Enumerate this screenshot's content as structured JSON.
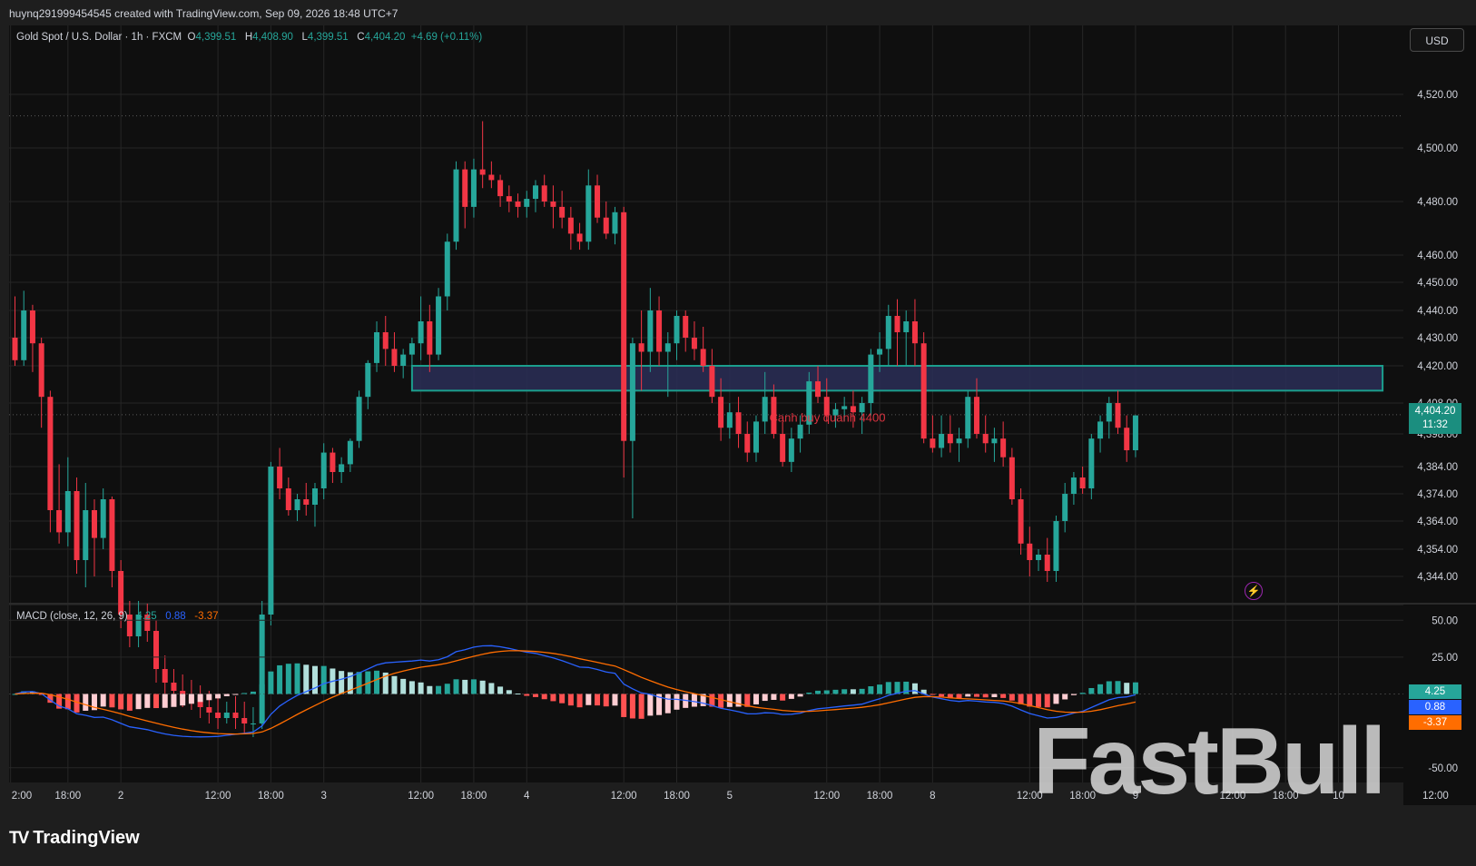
{
  "header": {
    "created_text": "huynq291999454545 created with TradingView.com, Sep 09, 2026 18:48 UTC+7"
  },
  "legend": {
    "symbol": "Gold Spot / U.S. Dollar · 1h · FXCM",
    "o_label": "O",
    "o_value": "4,399.51",
    "h_label": "H",
    "h_value": "4,408.90",
    "l_label": "L",
    "l_value": "4,399.51",
    "c_label": "C",
    "c_value": "4,404.20",
    "change": "+4.69 (+0.11%)"
  },
  "currency": "USD",
  "last_price": {
    "price": "4,404.20",
    "countdown": "11:32"
  },
  "macd_legend": {
    "label": "MACD (close, 12, 26, 9)",
    "macd": "4.25",
    "signal": "0.88",
    "hist": "-3.37"
  },
  "colors": {
    "up": "#26a69a",
    "down": "#f23645",
    "macd": "#2962ff",
    "signal": "#ff6d00",
    "zone": "#2a2e57",
    "zone_border": "#1b9e8d"
  },
  "footer": {
    "brand": "TradingView"
  },
  "watermark": "FastBull",
  "chart_data": {
    "type": "candlestick",
    "price_axis": {
      "ticks": [
        4344,
        4354,
        4364,
        4374,
        4384,
        4398,
        4408,
        4420,
        4430,
        4440,
        4450,
        4460,
        4480,
        4500,
        4520
      ],
      "tick_labels": [
        "4,344.00",
        "4,354.00",
        "4,364.00",
        "4,374.00",
        "4,384.00",
        "4,398.00",
        "4,408.00",
        "4,420.00",
        "4,430.00",
        "4,440.00",
        "4,450.00",
        "4,460.00",
        "4,480.00",
        "4,500.00",
        "4,520.00"
      ]
    },
    "time_axis": {
      "labels": [
        "2:00",
        "18:00",
        "2",
        "12:00",
        "18:00",
        "3",
        "12:00",
        "18:00",
        "4",
        "12:00",
        "18:00",
        "5",
        "12:00",
        "18:00",
        "8",
        "12:00",
        "18:00",
        "9",
        "12:00",
        "18:00",
        "10",
        "12:00"
      ],
      "label_bar_index": [
        -0.5,
        6,
        12,
        23,
        29,
        35,
        46,
        52,
        58,
        69,
        75,
        81,
        92,
        98,
        104,
        115,
        121,
        127,
        138,
        144,
        150,
        161
      ]
    },
    "annotation": {
      "text": "Canh buy quanh 4400",
      "zone_low": 4412,
      "zone_high": 4420,
      "zone_start_bar": 45,
      "zone_end_bar": 155
    },
    "candles": [
      [
        4430,
        4445,
        4420,
        4422
      ],
      [
        4422,
        4447,
        4420,
        4440
      ],
      [
        4440,
        4442,
        4418,
        4428
      ],
      [
        4428,
        4430,
        4400,
        4410
      ],
      [
        4410,
        4412,
        4360,
        4368
      ],
      [
        4368,
        4385,
        4356,
        4360
      ],
      [
        4360,
        4388,
        4355,
        4375
      ],
      [
        4375,
        4380,
        4345,
        4350
      ],
      [
        4350,
        4378,
        4340,
        4368
      ],
      [
        4368,
        4372,
        4344,
        4358
      ],
      [
        4358,
        4376,
        4354,
        4372
      ],
      [
        4372,
        4373,
        4340,
        4346
      ],
      [
        4346,
        4350,
        4325,
        4330
      ],
      [
        4330,
        4335,
        4318,
        4322
      ],
      [
        4322,
        4335,
        4318,
        4330
      ],
      [
        4330,
        4334,
        4320,
        4324
      ],
      [
        4324,
        4328,
        4305,
        4310
      ],
      [
        4310,
        4315,
        4300,
        4305
      ],
      [
        4305,
        4310,
        4298,
        4302
      ],
      [
        4302,
        4308,
        4296,
        4300
      ],
      [
        4300,
        4306,
        4295,
        4298
      ],
      [
        4298,
        4304,
        4292,
        4296
      ],
      [
        4296,
        4302,
        4290,
        4294
      ],
      [
        4294,
        4300,
        4288,
        4292
      ],
      [
        4292,
        4298,
        4290,
        4294
      ],
      [
        4294,
        4300,
        4288,
        4292
      ],
      [
        4292,
        4298,
        4286,
        4290
      ],
      [
        4290,
        4296,
        4285,
        4290
      ],
      [
        4290,
        4335,
        4288,
        4330
      ],
      [
        4330,
        4386,
        4326,
        4384
      ],
      [
        4384,
        4392,
        4372,
        4376
      ],
      [
        4376,
        4380,
        4366,
        4368
      ],
      [
        4368,
        4374,
        4364,
        4372
      ],
      [
        4372,
        4378,
        4366,
        4370
      ],
      [
        4370,
        4378,
        4362,
        4376
      ],
      [
        4376,
        4394,
        4372,
        4390
      ],
      [
        4390,
        4392,
        4378,
        4382
      ],
      [
        4382,
        4388,
        4378,
        4385
      ],
      [
        4385,
        4396,
        4382,
        4395
      ],
      [
        4395,
        4412,
        4392,
        4410
      ],
      [
        4410,
        4422,
        4406,
        4421
      ],
      [
        4421,
        4436,
        4418,
        4432
      ],
      [
        4432,
        4438,
        4420,
        4426
      ],
      [
        4426,
        4432,
        4418,
        4420
      ],
      [
        4420,
        4426,
        4416,
        4424
      ],
      [
        4424,
        4430,
        4420,
        4428
      ],
      [
        4428,
        4445,
        4422,
        4436
      ],
      [
        4436,
        4442,
        4418,
        4424
      ],
      [
        4424,
        4448,
        4422,
        4445
      ],
      [
        4445,
        4468,
        4440,
        4465
      ],
      [
        4465,
        4495,
        4462,
        4492
      ],
      [
        4492,
        4495,
        4470,
        4478
      ],
      [
        4478,
        4496,
        4474,
        4492
      ],
      [
        4492,
        4510,
        4485,
        4490
      ],
      [
        4490,
        4495,
        4485,
        4488
      ],
      [
        4488,
        4490,
        4478,
        4482
      ],
      [
        4482,
        4486,
        4476,
        4480
      ],
      [
        4480,
        4483,
        4474,
        4478
      ],
      [
        4478,
        4484,
        4474,
        4481
      ],
      [
        4481,
        4488,
        4476,
        4486
      ],
      [
        4486,
        4490,
        4478,
        4480
      ],
      [
        4480,
        4486,
        4470,
        4478
      ],
      [
        4478,
        4484,
        4470,
        4474
      ],
      [
        4474,
        4478,
        4462,
        4468
      ],
      [
        4468,
        4472,
        4462,
        4465
      ],
      [
        4465,
        4492,
        4462,
        4486
      ],
      [
        4486,
        4490,
        4472,
        4474
      ],
      [
        4474,
        4480,
        4466,
        4468
      ],
      [
        4468,
        4478,
        4464,
        4476
      ],
      [
        4476,
        4478,
        4380,
        4395
      ],
      [
        4395,
        4430,
        4365,
        4428
      ],
      [
        4428,
        4440,
        4412,
        4425
      ],
      [
        4425,
        4448,
        4418,
        4440
      ],
      [
        4440,
        4445,
        4420,
        4425
      ],
      [
        4425,
        4432,
        4410,
        4428
      ],
      [
        4428,
        4440,
        4422,
        4438
      ],
      [
        4438,
        4440,
        4425,
        4430
      ],
      [
        4430,
        4436,
        4422,
        4426
      ],
      [
        4426,
        4434,
        4418,
        4420
      ],
      [
        4420,
        4426,
        4408,
        4410
      ],
      [
        4410,
        4416,
        4395,
        4400
      ],
      [
        4400,
        4408,
        4396,
        4405
      ],
      [
        4405,
        4410,
        4392,
        4398
      ],
      [
        4398,
        4402,
        4386,
        4390
      ],
      [
        4390,
        4404,
        4386,
        4402
      ],
      [
        4402,
        4418,
        4398,
        4410
      ],
      [
        4410,
        4414,
        4396,
        4398
      ],
      [
        4398,
        4402,
        4384,
        4386
      ],
      [
        4386,
        4400,
        4382,
        4396
      ],
      [
        4396,
        4404,
        4390,
        4401
      ],
      [
        4401,
        4418,
        4398,
        4415
      ],
      [
        4415,
        4420,
        4408,
        4410
      ],
      [
        4410,
        4416,
        4402,
        4404
      ],
      [
        4404,
        4408,
        4400,
        4406
      ],
      [
        4406,
        4410,
        4402,
        4407
      ],
      [
        4407,
        4412,
        4400,
        4405
      ],
      [
        4405,
        4410,
        4398,
        4408
      ],
      [
        4408,
        4426,
        4404,
        4424
      ],
      [
        4424,
        4432,
        4418,
        4426
      ],
      [
        4426,
        4442,
        4420,
        4438
      ],
      [
        4438,
        4444,
        4420,
        4432
      ],
      [
        4432,
        4440,
        4420,
        4436
      ],
      [
        4436,
        4444,
        4420,
        4428
      ],
      [
        4428,
        4432,
        4394,
        4396
      ],
      [
        4396,
        4404,
        4390,
        4392
      ],
      [
        4392,
        4404,
        4388,
        4398
      ],
      [
        4398,
        4404,
        4390,
        4394
      ],
      [
        4394,
        4400,
        4386,
        4396
      ],
      [
        4396,
        4412,
        4392,
        4410
      ],
      [
        4410,
        4416,
        4396,
        4398
      ],
      [
        4398,
        4404,
        4390,
        4394
      ],
      [
        4394,
        4400,
        4386,
        4396
      ],
      [
        4396,
        4402,
        4384,
        4388
      ],
      [
        4388,
        4392,
        4370,
        4372
      ],
      [
        4372,
        4376,
        4352,
        4356
      ],
      [
        4356,
        4362,
        4344,
        4350
      ],
      [
        4350,
        4354,
        4346,
        4352
      ],
      [
        4352,
        4358,
        4342,
        4346
      ],
      [
        4346,
        4366,
        4342,
        4364
      ],
      [
        4364,
        4378,
        4360,
        4374
      ],
      [
        4374,
        4382,
        4370,
        4380
      ],
      [
        4380,
        4384,
        4374,
        4376
      ],
      [
        4376,
        4398,
        4372,
        4396
      ],
      [
        4396,
        4404,
        4390,
        4402
      ],
      [
        4402,
        4410,
        4396,
        4408
      ],
      [
        4408,
        4412,
        4398,
        4400
      ],
      [
        4400,
        4404,
        4386,
        4391
      ],
      [
        4391,
        4404,
        4388,
        4404
      ]
    ],
    "macd": {
      "ylim": [
        -60,
        60
      ],
      "tick_labels": [
        "50.00",
        "25.00",
        "-50.00"
      ],
      "ticks": [
        50,
        25,
        -50
      ],
      "last": {
        "macd": 4.25,
        "signal": 0.88,
        "hist": -3.37
      }
    }
  }
}
